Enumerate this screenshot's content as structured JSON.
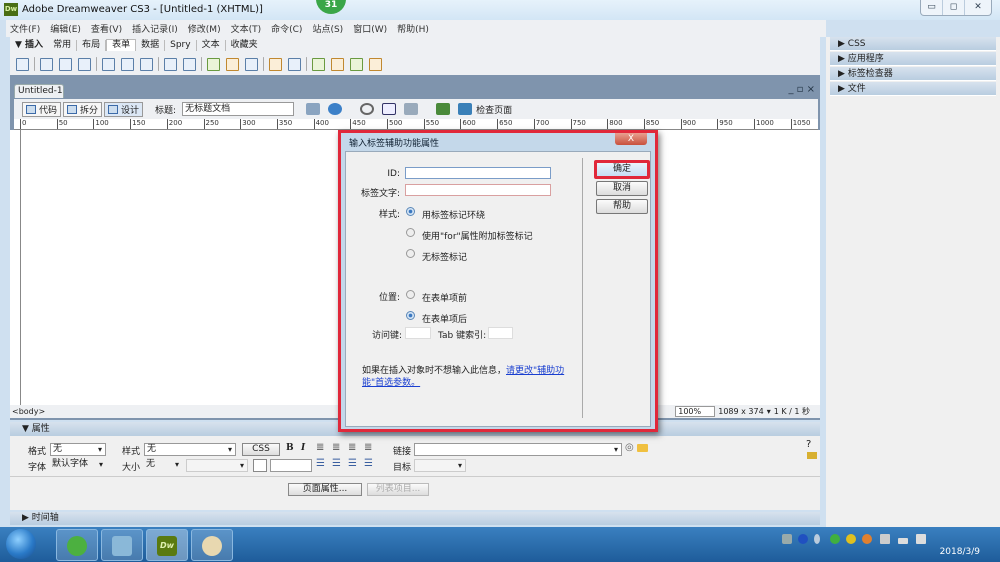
{
  "window": {
    "title": "Adobe Dreamweaver CS3 - [Untitled-1 (XHTML)]",
    "logo": "Dw",
    "badge": "31",
    "controls": [
      "minimize-icon",
      "restore-icon",
      "close-icon"
    ]
  },
  "menu": [
    "文件(F)",
    "编辑(E)",
    "查看(V)",
    "插入记录(I)",
    "修改(M)",
    "文本(T)",
    "命令(C)",
    "站点(S)",
    "窗口(W)",
    "帮助(H)"
  ],
  "insert_bar": {
    "label": "▼ 插入",
    "tabs": [
      "常用",
      "布局",
      "表单",
      "数据",
      "Spry",
      "文本",
      "收藏夹"
    ],
    "active_tab": "表单"
  },
  "right_panels": [
    "CSS",
    "应用程序",
    "标签检查器",
    "文件"
  ],
  "document": {
    "tab": "Untitled-1",
    "window_controls": "_ ▫ ×",
    "views": [
      "代码",
      "拆分",
      "设计"
    ],
    "active_view": "设计",
    "title_label": "标题:",
    "title_value": "无标题文档",
    "check_page": "检查页面",
    "ruler_ticks": [
      "0",
      "50",
      "100",
      "150",
      "200",
      "250",
      "300",
      "350",
      "400",
      "450",
      "500",
      "550",
      "600",
      "650",
      "700",
      "750",
      "800",
      "850",
      "900",
      "950",
      "1000",
      "1050"
    ],
    "tag_selector": "<body>",
    "zoom": "100%",
    "size": "1089 x 374",
    "download": "1 K / 1 秒"
  },
  "properties": {
    "header": "▼ 属性",
    "format_label": "格式",
    "format_value": "无",
    "style_label": "样式",
    "style_value": "无",
    "css_button": "CSS",
    "bold": "B",
    "italic": "I",
    "link_label": "链接",
    "font_label": "字体",
    "font_value": "默认字体",
    "size_label": "大小",
    "size_value": "无",
    "target_label": "目标",
    "page_props_button": "页面属性...",
    "list_item_button": "列表项目..."
  },
  "timeline": "▶ 时间轴",
  "dialog": {
    "title": "输入标签辅助功能属性",
    "close": "X",
    "id_label": "ID:",
    "id_value": "",
    "label_text_label": "标签文字:",
    "label_text_value": "",
    "style_label": "样式:",
    "style_options": [
      "用标签标记环绕",
      "使用\"for\"属性附加标签标记",
      "无标签标记"
    ],
    "style_selected": 0,
    "position_label": "位置:",
    "position_options": [
      "在表单项前",
      "在表单项后"
    ],
    "position_selected": 1,
    "access_key_label": "访问键:",
    "access_key_value": "",
    "tab_index_label": "Tab 键索引:",
    "tab_index_value": "",
    "note": "如果在插入对象时不想输入此信息，",
    "note_link": "请更改\"辅助功能\"首选参数。",
    "ok": "确定",
    "cancel": "取消",
    "help": "帮助",
    "highlight_color": "#e0283a"
  },
  "taskbar": {
    "apps": [
      "ie-browser",
      "notepad",
      "dreamweaver",
      "paint"
    ],
    "dw_label": "Dw",
    "date": "2018/3/9"
  }
}
